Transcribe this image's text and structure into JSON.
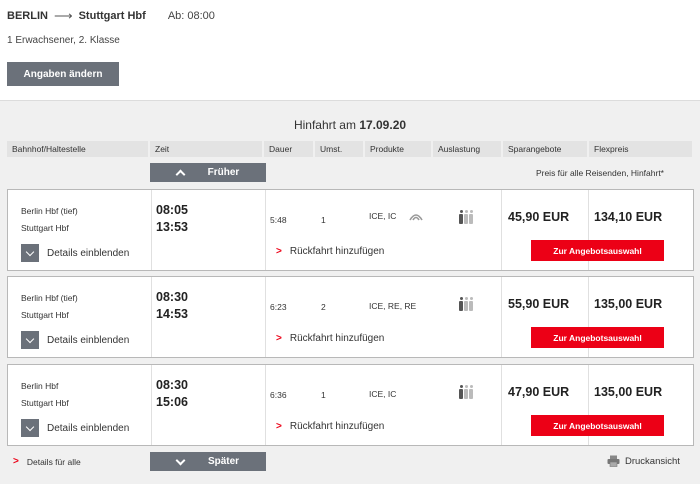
{
  "search": {
    "from": "BERLIN",
    "to": "Stuttgart Hbf",
    "departure": "Ab: 08:00",
    "passengers": "1 Erwachsener, 2. Klasse",
    "change_label": "Angaben ändern"
  },
  "results": {
    "title_prefix": "Hinfahrt am",
    "date": "17.09.20",
    "headers": [
      "Bahnhof/Haltestelle",
      "Zeit",
      "Dauer",
      "Umst.",
      "Produkte",
      "Auslastung",
      "Sparangebote",
      "Flexpreis"
    ],
    "earlier_label": "Früher",
    "later_label": "Später",
    "price_note": "Preis für alle Reisenden, Hinfahrt*",
    "connections": [
      {
        "from": "Berlin Hbf (tief)",
        "to": "Stuttgart Hbf",
        "dep": "08:05",
        "arr": "13:53",
        "duration": "5:48",
        "changes": "1",
        "products": "ICE, IC",
        "spar": "45,90 EUR",
        "flex": "134,10 EUR",
        "details_label": "Details einblenden",
        "return_label": "Rückfahrt hinzufügen",
        "offer_label": "Zur Angebotsauswahl",
        "load_icon": "occupancy-low-icon",
        "has_wifi": true
      },
      {
        "from": "Berlin Hbf (tief)",
        "to": "Stuttgart Hbf",
        "dep": "08:30",
        "arr": "14:53",
        "duration": "6:23",
        "changes": "2",
        "products": "ICE, RE, RE",
        "spar": "55,90 EUR",
        "flex": "135,00 EUR",
        "details_label": "Details einblenden",
        "return_label": "Rückfahrt hinzufügen",
        "offer_label": "Zur Angebotsauswahl",
        "load_icon": "occupancy-low-icon",
        "has_wifi": false
      },
      {
        "from": "Berlin Hbf",
        "to": "Stuttgart Hbf",
        "dep": "08:30",
        "arr": "15:06",
        "duration": "6:36",
        "changes": "1",
        "products": "ICE, IC",
        "spar": "47,90 EUR",
        "flex": "135,00 EUR",
        "details_label": "Details einblenden",
        "return_label": "Rückfahrt hinzufügen",
        "offer_label": "Zur Angebotsauswahl",
        "load_icon": "occupancy-low-icon",
        "has_wifi": false
      }
    ],
    "details_all_label": "Details für alle",
    "print_label": "Druckansicht"
  },
  "colors": {
    "accent_red": "#ec0016",
    "button_grey": "#6b717a"
  }
}
